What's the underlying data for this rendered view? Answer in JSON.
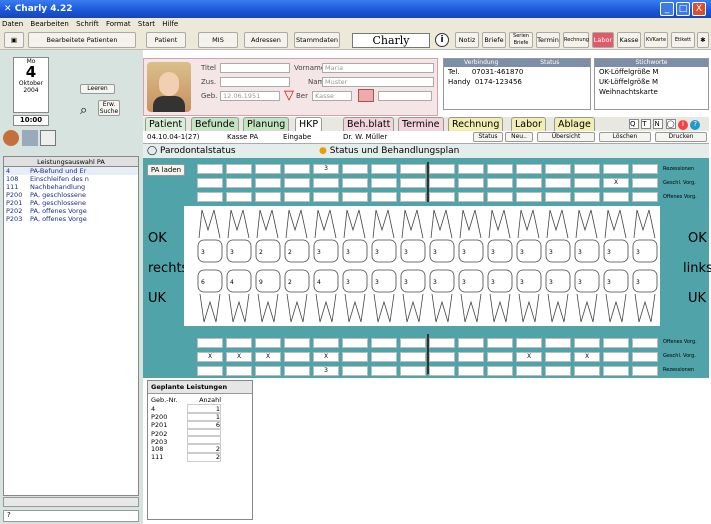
{
  "window": {
    "title": "Charly 4.22",
    "min": "_",
    "max": "□",
    "close": "X"
  },
  "menu": [
    "Daten",
    "Bearbeiten",
    "Schrift",
    "Format",
    "Start",
    "Hilfe"
  ],
  "toolbar": {
    "recent_patients": "Bearbeitete Patienten",
    "patient": "Patient",
    "mis": "MIS",
    "adressen": "Adressen",
    "stammdaten": "Stammdaten",
    "logo": "Charly",
    "notiz": "Notiz",
    "briefe": "Briefe",
    "serien_briefe": "Serien Briefe",
    "termin": "Termin",
    "rechnung": "Rechnung",
    "labor": "Labor",
    "kasse": "Kasse",
    "kvkarte": "KVKarte",
    "etik": "Etikett"
  },
  "calendar": {
    "weekday": "Mo",
    "day": "4",
    "month": "Oktober",
    "year": "2004",
    "time": "10:00",
    "leeren": "Leeren",
    "erw_suche": "Erw. Suche"
  },
  "leistungsauswahl": {
    "title": "Leistungsauswahl PA",
    "items": [
      {
        "code": "4",
        "text": "PA-Befund und Er"
      },
      {
        "code": "108",
        "text": "Einschleifen des n"
      },
      {
        "code": "111",
        "text": "Nachbehandlung"
      },
      {
        "code": "P200",
        "text": "PA, geschlossene"
      },
      {
        "code": "P201",
        "text": "PA, geschlossene"
      },
      {
        "code": "P202",
        "text": "PA, offenes Vorge"
      },
      {
        "code": "P203",
        "text": "PA, offenes Vorge"
      }
    ]
  },
  "patient": {
    "titel_label": "Titel",
    "zus_label": "Zus.",
    "geb_label": "Geb.",
    "geb": "12.06.1951",
    "vorname_label": "Vorname",
    "vorname": "Maria",
    "name_label": "Name",
    "name": "Muster",
    "ber_label": "Ber",
    "kasse": "Kasse"
  },
  "contact": {
    "header": "Verbindung",
    "status": "Status",
    "tel_label": "Tel.",
    "tel": "07031-461870",
    "handy_label": "Handy",
    "handy": "0174-123456"
  },
  "memo": {
    "header": "Stichworte",
    "items": [
      "OK-Löffelgröße M",
      "UK-Löffelgröße M",
      "Weihnachtskarte"
    ]
  },
  "tabs": [
    "Patient",
    "Befunde",
    "Planung",
    "HKP",
    "Beh.blatt",
    "Termine",
    "Rechnung",
    "Labor",
    "Ablage"
  ],
  "info": {
    "date": "04.10.04-1(27)",
    "kasse": "Kasse PA",
    "eingabe": "Eingabe",
    "doctor": "Dr. W. Müller",
    "status": "Status",
    "neu": "Neu..",
    "uebersicht": "Übersicht",
    "loeschen": "Löschen",
    "drucken": "Drucken"
  },
  "radio": {
    "opt1": "Parodontalstatus",
    "opt2": "Status und Behandlungsplan"
  },
  "chart": {
    "pa_laden": "PA laden",
    "upper_labels": [
      "Rezessionen",
      "Geschl. Vorg.",
      "Offenes Vorg."
    ],
    "lower_labels": [
      "Offenes Vorg.",
      "Geschl. Vorg.",
      "Rezessionen"
    ],
    "ok": "OK",
    "uk": "UK",
    "rechts": "rechts",
    "links": "links",
    "upper_rez_val": "3",
    "upper_gv_x_col": "X",
    "lower_gv_marks": [
      "X",
      "X",
      "X",
      "X",
      "X",
      "X"
    ],
    "lower_rez_val": "3",
    "upper_numbers": [
      "3",
      "3",
      "2",
      "2",
      "3",
      "3",
      "3",
      "3",
      "3",
      "3",
      "3",
      "3",
      "3",
      "3",
      "3",
      "3"
    ],
    "lower_numbers": [
      "6",
      "4",
      "9",
      "2",
      "4",
      "3",
      "3",
      "3",
      "3",
      "3",
      "3",
      "3",
      "3",
      "3",
      "3",
      "3"
    ]
  },
  "planned": {
    "title": "Geplante Leistungen",
    "col1": "Geb.-Nr.",
    "col2": "Anzahl",
    "rows": [
      {
        "code": "4",
        "n": "1"
      },
      {
        "code": "P200",
        "n": "1"
      },
      {
        "code": "P201",
        "n": "6"
      },
      {
        "code": "P202",
        "n": ""
      },
      {
        "code": "P203",
        "n": ""
      },
      {
        "code": "108",
        "n": "2"
      },
      {
        "code": "111",
        "n": "2"
      }
    ]
  },
  "colors": {
    "title": "#1a55d8",
    "teal": "#4fa3a9",
    "pink": "#f4e6e6"
  }
}
